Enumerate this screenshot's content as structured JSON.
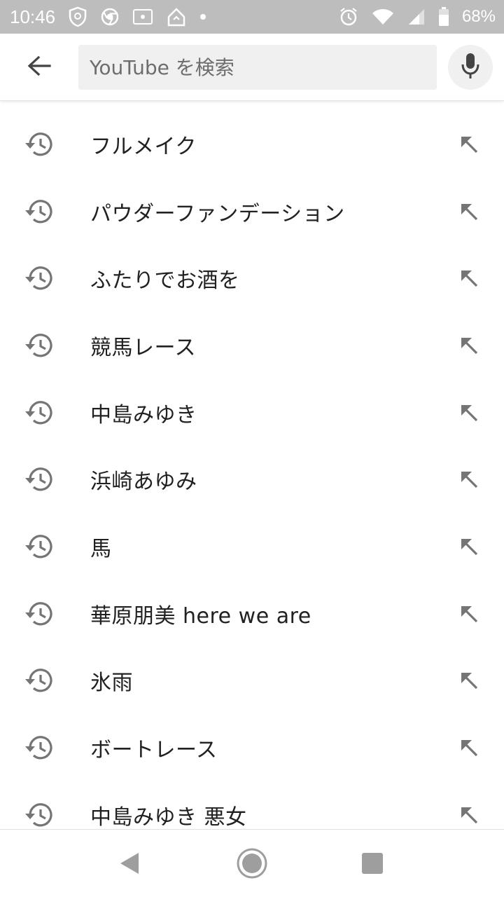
{
  "status_bar": {
    "time": "10:46",
    "battery_percent": "68%",
    "icons": [
      "shield-icon",
      "chrome-icon",
      "screencast-icon",
      "home-app-icon",
      "notification-dot-icon",
      "alarm-icon",
      "wifi-icon",
      "signal-icon",
      "battery-icon"
    ]
  },
  "search": {
    "placeholder": "YouTube を検索",
    "value": ""
  },
  "suggestions": [
    {
      "label": "フルメイク"
    },
    {
      "label": "パウダーファンデーション"
    },
    {
      "label": "ふたりでお酒を"
    },
    {
      "label": "競馬レース"
    },
    {
      "label": "中島みゆき"
    },
    {
      "label": "浜崎あゆみ"
    },
    {
      "label": "馬"
    },
    {
      "label": "華原朋美 here we are"
    },
    {
      "label": "氷雨"
    },
    {
      "label": "ボートレース"
    },
    {
      "label": "中島みゆき 悪女"
    }
  ],
  "colors": {
    "status_bar_bg": "#bdbdbd",
    "text_primary": "#212121",
    "icon_gray": "#757575",
    "search_bg": "#f0f0f0"
  }
}
